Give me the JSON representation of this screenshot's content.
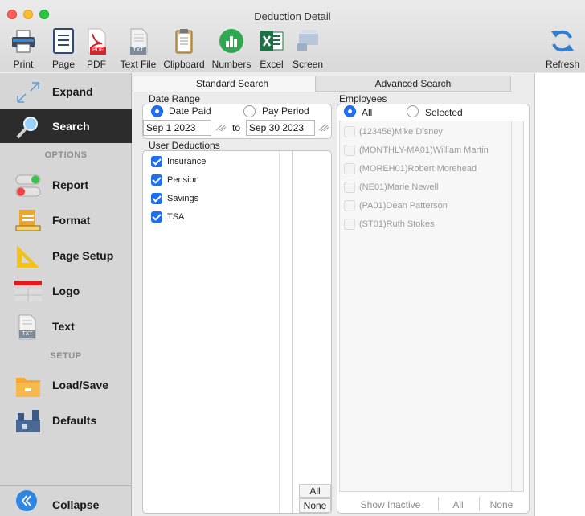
{
  "window": {
    "title": "Deduction Detail"
  },
  "toolbar": {
    "items": [
      {
        "label": "Print"
      },
      {
        "label": "Page"
      },
      {
        "label": "PDF"
      },
      {
        "label": "Text File"
      },
      {
        "label": "Clipboard"
      },
      {
        "label": "Numbers"
      },
      {
        "label": "Excel"
      },
      {
        "label": "Screen"
      }
    ],
    "refresh": {
      "label": "Refresh"
    },
    "pdf_badge": "PDF",
    "txt_badge": "TXT"
  },
  "sidebar": {
    "expand": "Expand",
    "search": "Search",
    "options_heading": "OPTIONS",
    "report": "Report",
    "format": "Format",
    "page_setup": "Page Setup",
    "logo": "Logo",
    "text": "Text",
    "text_badge": "TXT",
    "setup_heading": "SETUP",
    "load_save": "Load/Save",
    "defaults": "Defaults",
    "collapse": "Collapse"
  },
  "tabs": {
    "standard": "Standard Search",
    "advanced": "Advanced Search"
  },
  "date_range": {
    "label": "Date Range",
    "option_paid": "Date Paid",
    "option_period": "Pay Period",
    "selected": "Date Paid",
    "from": "Sep 1 2023",
    "to_label": "to",
    "to": "Sep 30 2023"
  },
  "user_deductions": {
    "label": "User Deductions",
    "items": [
      {
        "name": "Insurance",
        "checked": true
      },
      {
        "name": "Pension",
        "checked": true
      },
      {
        "name": "Savings",
        "checked": true
      },
      {
        "name": "TSA",
        "checked": true
      }
    ],
    "all_button": "All",
    "none_button": "None"
  },
  "employees": {
    "label": "Employees",
    "option_all": "All",
    "option_selected": "Selected",
    "selected": "All",
    "items": [
      {
        "name": "(123456)Mike Disney"
      },
      {
        "name": "(MONTHLY-MA01)William Martin"
      },
      {
        "name": "(MOREH01)Robert Morehead"
      },
      {
        "name": "(NE01)Marie Newell"
      },
      {
        "name": "(PA01)Dean Patterson"
      },
      {
        "name": "(ST01)Ruth Stokes"
      }
    ],
    "show_inactive": "Show Inactive",
    "all_button": "All",
    "none_button": "None"
  },
  "colors": {
    "accent": "#1f6ff2",
    "active_sidebar": "#2c2c2c"
  }
}
